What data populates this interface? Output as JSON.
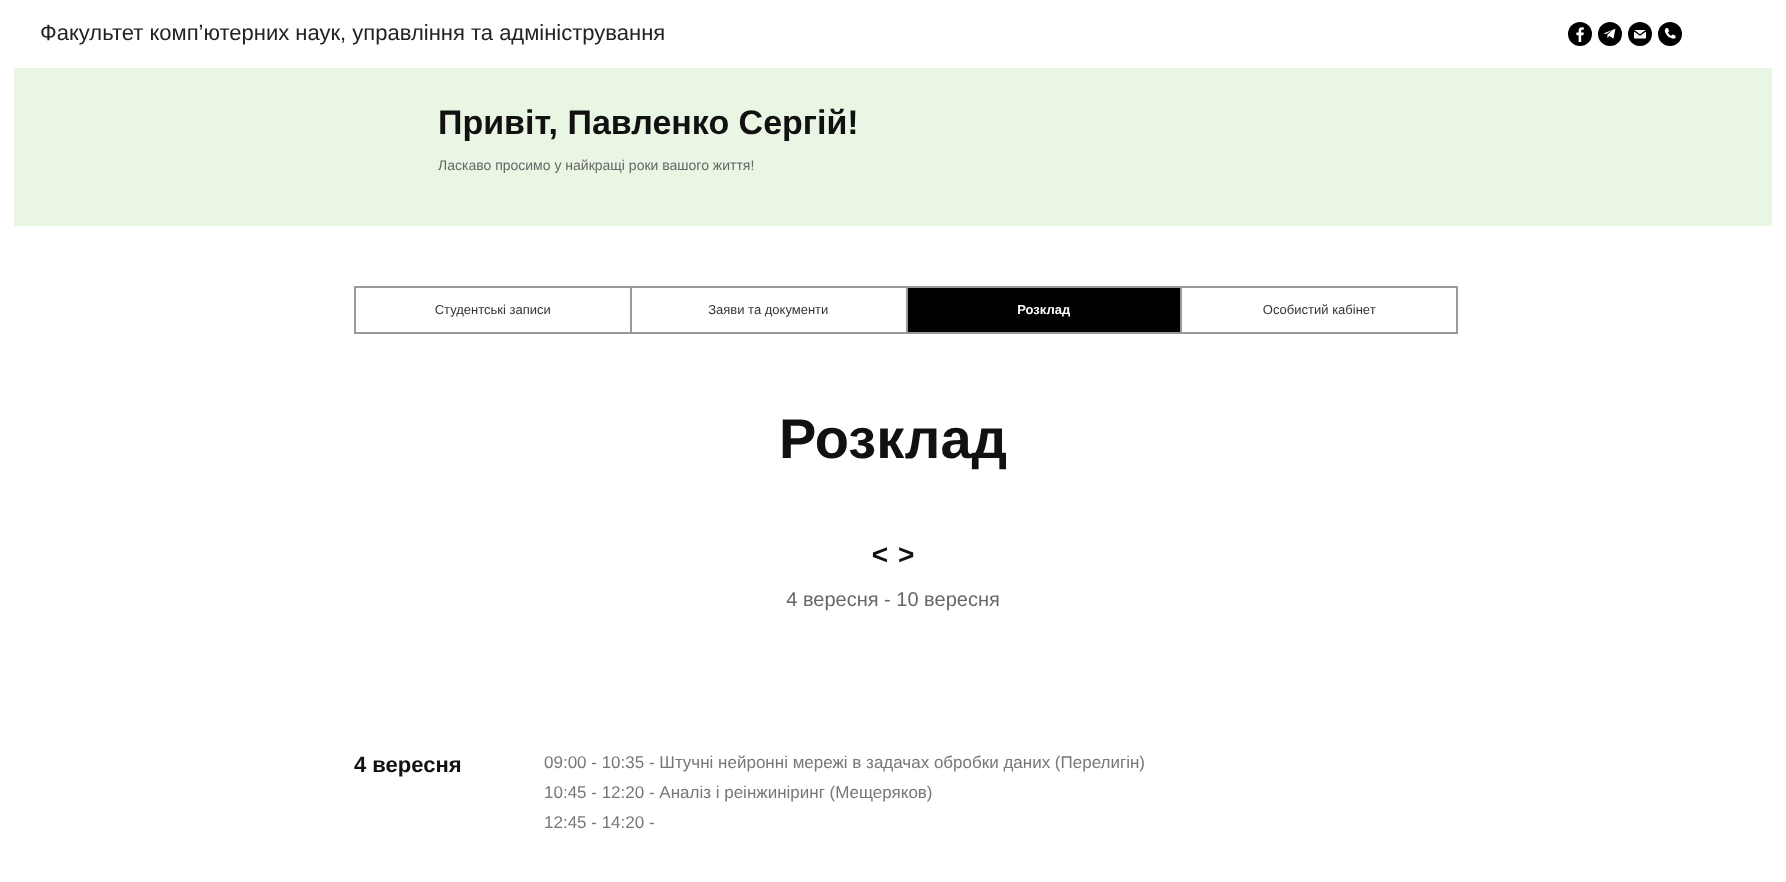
{
  "header": {
    "title": "Факультет комп’ютерних наук, управління та адміністрування"
  },
  "banner": {
    "greeting": "Привіт, Павленко Сергій!",
    "subtitle": "Ласкаво просимо у найкращі роки вашого життя!"
  },
  "tabs": [
    {
      "label": "Студентські записи",
      "selected": false
    },
    {
      "label": "Заяви та документи",
      "selected": false
    },
    {
      "label": "Розклад",
      "selected": true
    },
    {
      "label": "Особистий кабінет",
      "selected": false
    }
  ],
  "page_title": "Розклад",
  "week_nav": {
    "prev": "<",
    "next": ">",
    "range": "4 вересня - 10 вересня"
  },
  "schedule": [
    {
      "date": "4 вересня",
      "lessons": [
        "09:00 - 10:35 - Штучні нейронні мережі в задачах обробки даних (Перелигін)",
        "10:45 - 12:20 - Аналіз і реінжиніринг (Мещеряков)",
        "12:45 - 14:20 -"
      ]
    }
  ]
}
